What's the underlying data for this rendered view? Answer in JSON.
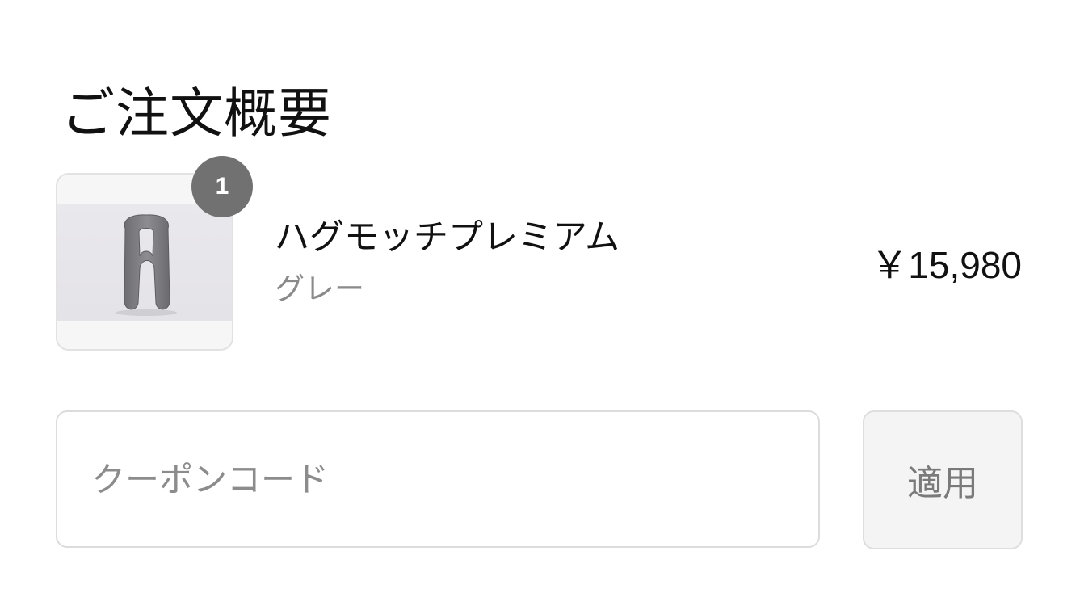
{
  "summary": {
    "title": "ご注文概要"
  },
  "line_item": {
    "image_alt": "ハグモッチプレミアム グレー",
    "quantity": "1",
    "name": "ハグモッチプレミアム",
    "variant": "グレー",
    "price": "￥15,980"
  },
  "coupon": {
    "placeholder": "クーポンコード",
    "value": "",
    "apply_label": "適用"
  },
  "colors": {
    "badge": "#717171",
    "border": "#dcdcdc",
    "button_bg": "#f4f4f4",
    "muted_text": "#8a8a8a"
  }
}
